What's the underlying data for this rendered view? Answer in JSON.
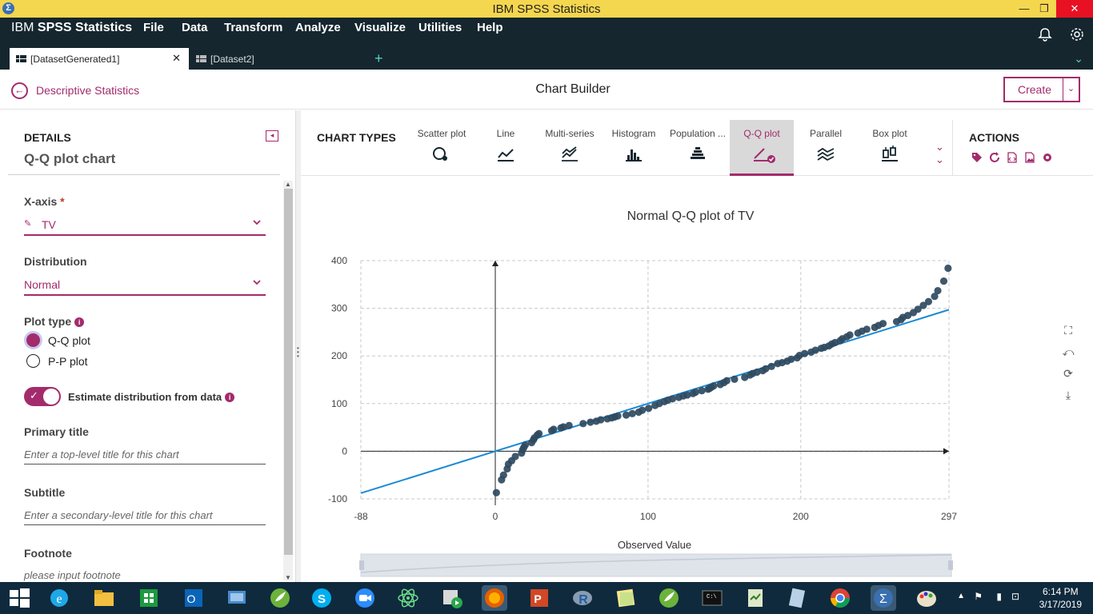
{
  "window": {
    "title": "IBM SPSS Statistics"
  },
  "menubar": {
    "brand_light": "IBM",
    "brand_bold": "SPSS Statistics",
    "items": [
      "File",
      "Data",
      "Transform",
      "Analyze",
      "Visualize",
      "Utilities",
      "Help"
    ]
  },
  "tabs": [
    {
      "label": "[DatasetGenerated1]",
      "active": true,
      "closable": true
    },
    {
      "label": "[Dataset2]",
      "active": false,
      "closable": false
    }
  ],
  "header": {
    "back_label": "Descriptive Statistics",
    "title": "Chart Builder",
    "create_label": "Create"
  },
  "details": {
    "heading": "DETAILS",
    "chart_name": "Q-Q plot chart",
    "xaxis_label": "X-axis",
    "xaxis_required": "*",
    "xaxis_value": "TV",
    "distribution_label": "Distribution",
    "distribution_value": "Normal",
    "plot_type_label": "Plot type",
    "plot_types": [
      "Q-Q plot",
      "P-P plot"
    ],
    "plot_type_selected": "Q-Q plot",
    "estimate_label": "Estimate distribution from data",
    "estimate_on": true,
    "primary_title_label": "Primary title",
    "primary_title_placeholder": "Enter a top-level title for this chart",
    "subtitle_label": "Subtitle",
    "subtitle_placeholder": "Enter a secondary-level title for this chart",
    "footnote_label": "Footnote",
    "footnote_placeholder": "please input footnote"
  },
  "chart_types": {
    "heading": "CHART TYPES",
    "items": [
      "Scatter plot",
      "Line",
      "Multi-series",
      "Histogram",
      "Population ...",
      "Q-Q plot",
      "Parallel",
      "Box plot"
    ],
    "selected": "Q-Q plot"
  },
  "actions": {
    "heading": "ACTIONS",
    "icons": [
      "tag-icon",
      "refresh-icon",
      "code-icon",
      "image-icon",
      "settings-icon"
    ]
  },
  "side_tools": [
    "crop-icon",
    "crop-reset-icon",
    "rotate-icon",
    "download-icon"
  ],
  "colors": {
    "accent": "#a32b6c",
    "menubar": "#15262f",
    "titlebar": "#f5d64f",
    "points": "#2f4a60",
    "ref_line": "#1a8ad4"
  },
  "chart_data": {
    "type": "scatter",
    "title": "Normal Q-Q plot of TV",
    "xlabel": "Observed Value",
    "ylabel": "",
    "x_ticks": [
      -88,
      0,
      100,
      200,
      297
    ],
    "y_ticks": [
      -100,
      0,
      100,
      200,
      300,
      400
    ],
    "xlim": [
      -88,
      297
    ],
    "ylim": [
      -100,
      400
    ],
    "grid": true,
    "reference_line": {
      "x": [
        -88,
        297
      ],
      "y": [
        -88,
        297
      ]
    },
    "points": [
      [
        0.7,
        -87
      ],
      [
        4.1,
        -60
      ],
      [
        5.4,
        -50
      ],
      [
        7.8,
        -37
      ],
      [
        8.6,
        -27
      ],
      [
        10.7,
        -20
      ],
      [
        13.1,
        -11
      ],
      [
        17.2,
        -4
      ],
      [
        17.9,
        3
      ],
      [
        18.7,
        8
      ],
      [
        19.6,
        13
      ],
      [
        23.8,
        18
      ],
      [
        25.0,
        24
      ],
      [
        25.6,
        28
      ],
      [
        27.5,
        34
      ],
      [
        28.6,
        37
      ],
      [
        36.9,
        43
      ],
      [
        38.2,
        46
      ],
      [
        43.0,
        49
      ],
      [
        44.5,
        51
      ],
      [
        48.3,
        54
      ],
      [
        57.5,
        58
      ],
      [
        62.3,
        61
      ],
      [
        66.1,
        63
      ],
      [
        69.0,
        66
      ],
      [
        73.4,
        68
      ],
      [
        76.3,
        70
      ],
      [
        78.2,
        72
      ],
      [
        80.2,
        74
      ],
      [
        85.7,
        76
      ],
      [
        89.7,
        79
      ],
      [
        93.9,
        82
      ],
      [
        96.2,
        86
      ],
      [
        100.4,
        90
      ],
      [
        104.6,
        96
      ],
      [
        107.4,
        100
      ],
      [
        110.7,
        104
      ],
      [
        112.9,
        107
      ],
      [
        116.0,
        110
      ],
      [
        120.2,
        113
      ],
      [
        123.1,
        116
      ],
      [
        125.7,
        118
      ],
      [
        129.4,
        121
      ],
      [
        131.1,
        124
      ],
      [
        135.2,
        127
      ],
      [
        139.3,
        130
      ],
      [
        140.3,
        132
      ],
      [
        141.3,
        134
      ],
      [
        142.9,
        137
      ],
      [
        147.3,
        140
      ],
      [
        149.7,
        144
      ],
      [
        151.5,
        148
      ],
      [
        156.6,
        151
      ],
      [
        163.3,
        155
      ],
      [
        166.8,
        160
      ],
      [
        168.4,
        163
      ],
      [
        171.3,
        166
      ],
      [
        175.1,
        169
      ],
      [
        177.0,
        173
      ],
      [
        180.8,
        178
      ],
      [
        184.9,
        184
      ],
      [
        187.8,
        186
      ],
      [
        191.1,
        189
      ],
      [
        193.7,
        193
      ],
      [
        197.6,
        196
      ],
      [
        199.1,
        201
      ],
      [
        202.5,
        205
      ],
      [
        206.8,
        208
      ],
      [
        209.6,
        212
      ],
      [
        213.4,
        216
      ],
      [
        215.4,
        218
      ],
      [
        218.4,
        221
      ],
      [
        220.3,
        225
      ],
      [
        222.4,
        228
      ],
      [
        225.8,
        232
      ],
      [
        227.2,
        236
      ],
      [
        230.1,
        240
      ],
      [
        232.1,
        244
      ],
      [
        237.4,
        248
      ],
      [
        240.1,
        252
      ],
      [
        243.2,
        256
      ],
      [
        248.4,
        260
      ],
      [
        250.9,
        264
      ],
      [
        253.8,
        268
      ],
      [
        262.7,
        272
      ],
      [
        265.6,
        276
      ],
      [
        266.9,
        281
      ],
      [
        270.1,
        285
      ],
      [
        273.7,
        291
      ],
      [
        276.7,
        298
      ],
      [
        280.2,
        306
      ],
      [
        283.6,
        314
      ],
      [
        287.6,
        325
      ],
      [
        289.7,
        337
      ],
      [
        293.6,
        357
      ],
      [
        296.4,
        384
      ]
    ]
  },
  "taskbar": {
    "clock_time": "6:14 PM",
    "clock_date": "3/17/2019",
    "apps": [
      "windows-start-icon",
      "internet-explorer-icon",
      "file-explorer-icon",
      "store-icon",
      "outlook-icon",
      "remote-desktop-icon",
      "spring-icon",
      "skype-icon",
      "zoom-icon",
      "atom-icon",
      "media-player-icon",
      "firefox-icon",
      "powerpoint-icon",
      "r-icon",
      "sticky-notes-icon",
      "spring-tool-icon",
      "terminal-icon",
      "notepad-icon",
      "notebook-icon",
      "chrome-icon",
      "spss-icon",
      "paint-icon"
    ]
  }
}
